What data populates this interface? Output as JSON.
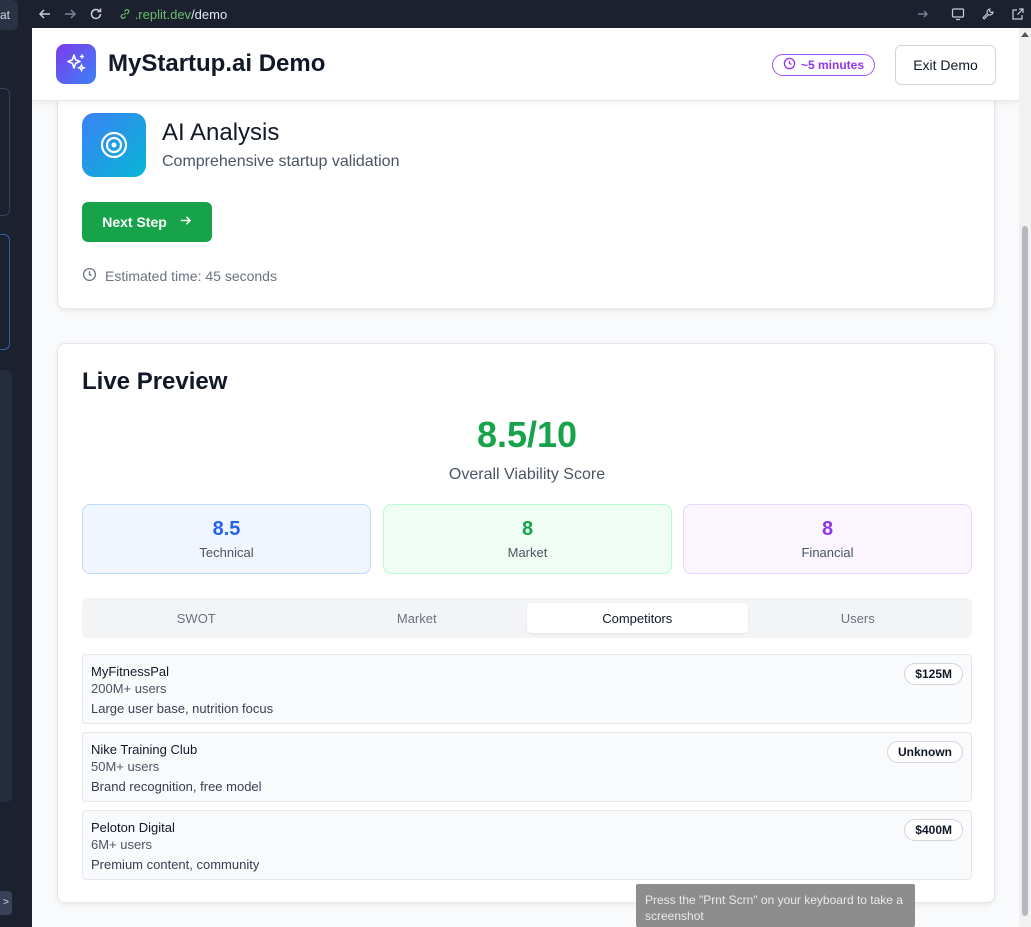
{
  "side": {
    "tab_label": "at",
    "bottom_btn": ">"
  },
  "browser": {
    "url_host": ".replit.dev",
    "url_path": "/demo"
  },
  "header": {
    "title": "MyStartup.ai Demo",
    "time_badge": "~5 minutes",
    "exit_label": "Exit Demo"
  },
  "step": {
    "title": "AI Analysis",
    "subtitle": "Comprehensive startup validation",
    "next_label": "Next Step",
    "estimate": "Estimated time: 45 seconds"
  },
  "preview": {
    "title": "Live Preview",
    "score": "8.5/10",
    "score_label": "Overall Viability Score",
    "metrics": [
      {
        "value": "8.5",
        "label": "Technical"
      },
      {
        "value": "8",
        "label": "Market"
      },
      {
        "value": "8",
        "label": "Financial"
      }
    ],
    "tabs": [
      "SWOT",
      "Market",
      "Competitors",
      "Users"
    ],
    "active_tab": "Competitors",
    "competitors": [
      {
        "name": "MyFitnessPal",
        "users": "200M+ users",
        "desc": "Large user base, nutrition focus",
        "badge": "$125M"
      },
      {
        "name": "Nike Training Club",
        "users": "50M+ users",
        "desc": "Brand recognition, free model",
        "badge": "Unknown"
      },
      {
        "name": "Peloton Digital",
        "users": "6M+ users",
        "desc": "Premium content, community",
        "badge": "$400M"
      }
    ]
  },
  "tooltip": "Press the \"Prnt Scrn\" on your keyboard to take a screenshot",
  "colors": {
    "accent_green": "#16a34a",
    "accent_purple": "#9333ea",
    "accent_blue": "#2563eb"
  }
}
